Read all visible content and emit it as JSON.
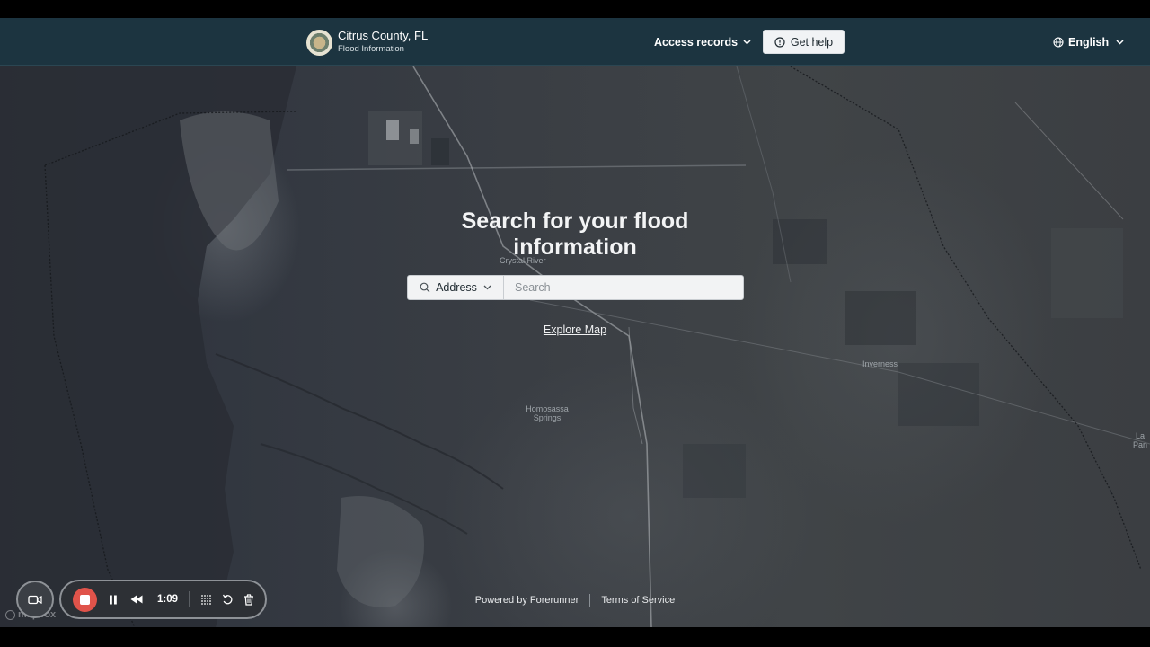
{
  "header": {
    "brand": {
      "title": "Citrus County, FL",
      "subtitle": "Flood Information",
      "logo_icon": "county-seal-logo"
    },
    "nav": {
      "access_records_label": "Access records",
      "get_help_label": "Get help",
      "language_label": "English"
    }
  },
  "map": {
    "place_labels": [
      "Crystal River",
      "Homosassa Springs",
      "Inverness",
      "La Pan"
    ],
    "attribution_logo": "mapbox"
  },
  "hero": {
    "title": "Search for your flood information",
    "search": {
      "type_label": "Address",
      "placeholder": "Search",
      "value": ""
    },
    "explore_link": "Explore Map"
  },
  "footer": {
    "powered_by": "Powered by Forerunner",
    "terms": "Terms of Service"
  },
  "recorder": {
    "timer": "1:09",
    "icons": [
      "camera-icon",
      "stop-icon",
      "pause-icon",
      "rewind-icon",
      "grid-icon",
      "restart-icon",
      "trash-icon"
    ]
  },
  "colors": {
    "header_bg": "#1c3440",
    "map_bg": "#3a3e44",
    "record_red": "#e0534a"
  }
}
